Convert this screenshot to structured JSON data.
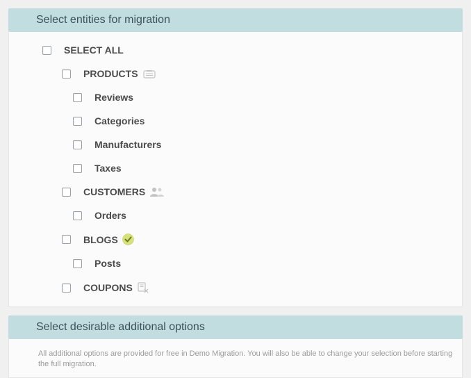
{
  "panels": {
    "entities": {
      "title": "Select entities for migration",
      "select_all": "SELECT ALL",
      "products": {
        "label": "PRODUCTS",
        "reviews": "Reviews",
        "categories": "Categories",
        "manufacturers": "Manufacturers",
        "taxes": "Taxes"
      },
      "customers": {
        "label": "CUSTOMERS",
        "orders": "Orders"
      },
      "blogs": {
        "label": "BLOGS",
        "posts": "Posts"
      },
      "coupons": {
        "label": "COUPONS"
      }
    },
    "options": {
      "title": "Select desirable additional options",
      "info": "All additional options are provided for free in Demo Migration. You will also be able to change your selection before starting the full migration."
    }
  }
}
